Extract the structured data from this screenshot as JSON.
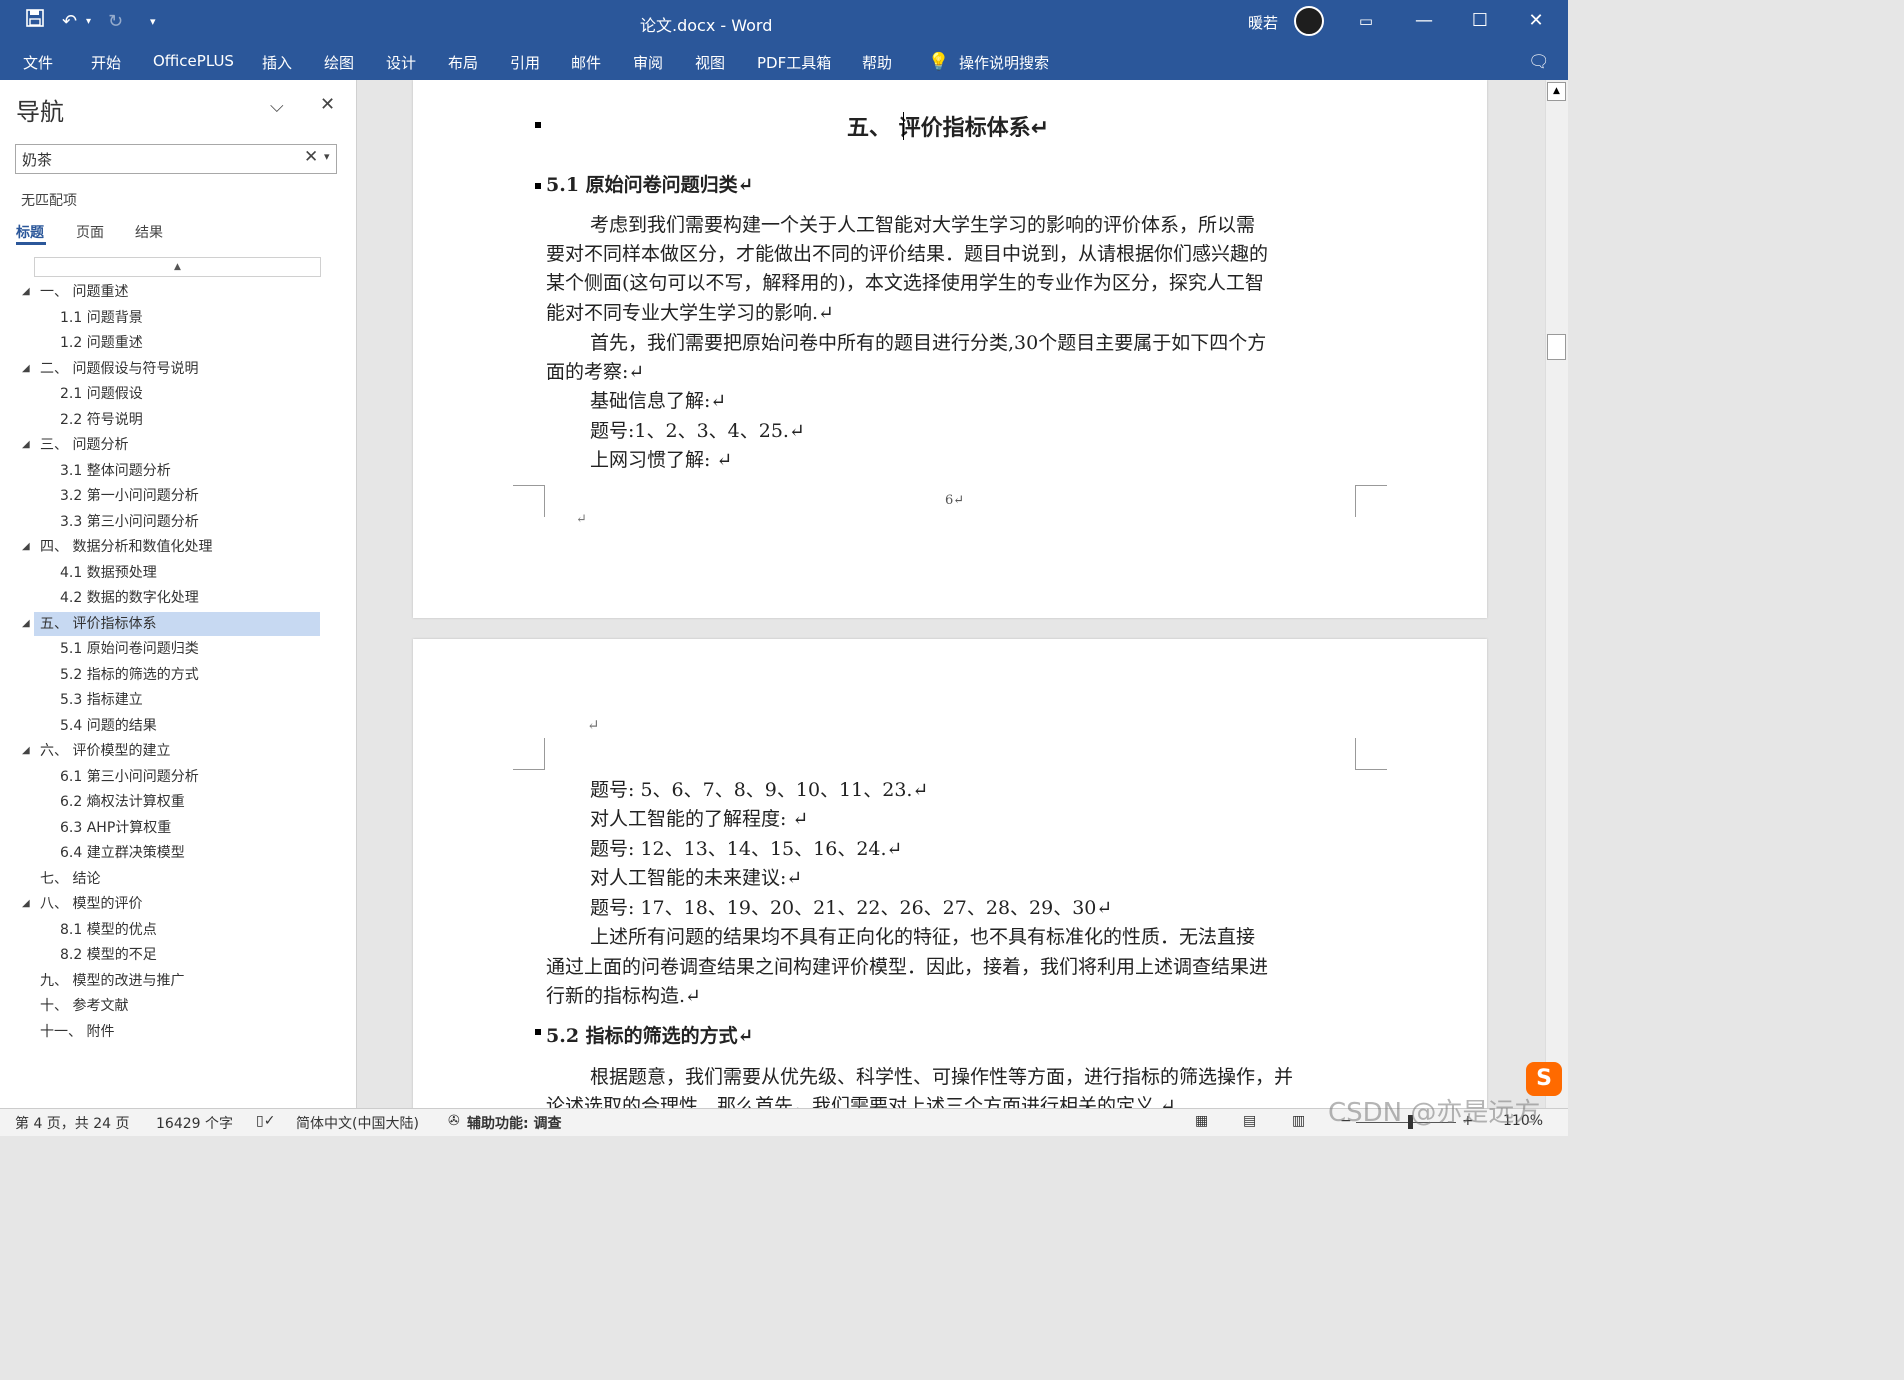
{
  "titlebar": {
    "title": "论文.docx  -  Word",
    "user": "暖若",
    "save_icon": "save-icon",
    "undo_icon": "undo-icon"
  },
  "menu": [
    "文件",
    "开始",
    "OfficePLUS",
    "插入",
    "绘图",
    "设计",
    "布局",
    "引用",
    "邮件",
    "审阅",
    "视图",
    "PDF工具箱",
    "帮助",
    "操作说明搜索"
  ],
  "nav": {
    "title": "导航",
    "search_value": "奶茶",
    "no_match": "无匹配项",
    "tabs": [
      "标题",
      "页面",
      "结果"
    ],
    "tree": [
      {
        "label": "一、 问题重述",
        "level": 1,
        "expanded": true
      },
      {
        "label": "1.1 问题背景",
        "level": 2
      },
      {
        "label": "1.2 问题重述",
        "level": 2
      },
      {
        "label": "二、 问题假设与符号说明",
        "level": 1,
        "expanded": true
      },
      {
        "label": "2.1 问题假设",
        "level": 2
      },
      {
        "label": "2.2 符号说明",
        "level": 2
      },
      {
        "label": "三、 问题分析",
        "level": 1,
        "expanded": true
      },
      {
        "label": "3.1 整体问题分析",
        "level": 2
      },
      {
        "label": "3.2 第一小问问题分析",
        "level": 2
      },
      {
        "label": "3.3 第三小问问题分析",
        "level": 2
      },
      {
        "label": "四、 数据分析和数值化处理",
        "level": 1,
        "expanded": true
      },
      {
        "label": "4.1 数据预处理",
        "level": 2
      },
      {
        "label": "4.2 数据的数字化处理",
        "level": 2
      },
      {
        "label": "五、 评价指标体系",
        "level": 1,
        "expanded": true,
        "selected": true
      },
      {
        "label": "5.1 原始问卷问题归类",
        "level": 2
      },
      {
        "label": "5.2 指标的筛选的方式",
        "level": 2
      },
      {
        "label": "5.3 指标建立",
        "level": 2
      },
      {
        "label": "5.4 问题的结果",
        "level": 2
      },
      {
        "label": "六、 评价模型的建立",
        "level": 1,
        "expanded": true
      },
      {
        "label": "6.1 第三小问问题分析",
        "level": 2
      },
      {
        "label": "6.2 熵权法计算权重",
        "level": 2
      },
      {
        "label": "6.3 AHP计算权重",
        "level": 2
      },
      {
        "label": "6.4 建立群决策模型",
        "level": 2
      },
      {
        "label": "七、 结论",
        "level": 1
      },
      {
        "label": "八、 模型的评价",
        "level": 1,
        "expanded": true
      },
      {
        "label": "8.1 模型的优点",
        "level": 2
      },
      {
        "label": "8.2 模型的不足",
        "level": 2
      },
      {
        "label": "九、 模型的改进与推广",
        "level": 1
      },
      {
        "label": "十、 参考文献",
        "level": 1
      },
      {
        "label": "十一、 附件",
        "level": 1
      }
    ]
  },
  "doc": {
    "page1": {
      "chapter": "五、 评价指标体系↵",
      "sub1": "5.1 原始问卷问题归类↵",
      "lines": [
        "考虑到我们需要构建一个关于人工智能对大学生学习的影响的评价体系，所以需",
        "要对不同样本做区分，才能做出不同的评价结果．题目中说到，从请根据你们感兴趣的",
        "某个侧面(这句可以不写，解释用的)，本文选择使用学生的专业作为区分，探究人工智",
        "能对不同专业大学生学习的影响.↵",
        "首先，我们需要把原始问卷中所有的题目进行分类,30个题目主要属于如下四个方",
        "面的考察:↵",
        "基础信息了解:↵",
        "题号:1、2、3、4、25.↵",
        "上网习惯了解: ↵"
      ],
      "page_number": "6↵",
      "end_mark": "↵"
    },
    "page2": {
      "start_mark": "↵",
      "lines": [
        "题号: 5、6、7、8、9、10、11、23.↵",
        "对人工智能的了解程度: ↵",
        "题号: 12、13、14、15、16、24.↵",
        "对人工智能的未来建议:↵",
        "题号: 17、18、19、20、21、22、26、27、28、29、30↵",
        "上述所有问题的结果均不具有正向化的特征，也不具有标准化的性质．无法直接",
        "通过上面的问卷调查结果之间构建评价模型．因此，接着，我们将利用上述调查结果进",
        "行新的指标构造.↵"
      ],
      "sub2": "5.2 指标的筛选的方式↵",
      "lines2": [
        "根据题意，我们需要从优先级、科学性、可操作性等方面，进行指标的筛选操作，并",
        "论述选取的合理性．那么首先，我们需要对上述三个方面进行相关的定义.↵"
      ]
    }
  },
  "status": {
    "page": "第 4 页，共 24 页",
    "words": "16429 个字",
    "language": "简体中文(中国大陆)",
    "accessibility": "辅助功能: 调查",
    "zoom": "110%",
    "watermark": "CSDN @亦是远方"
  },
  "colors": {
    "accent": "#2b579a",
    "selected": "#c7d9f2"
  }
}
